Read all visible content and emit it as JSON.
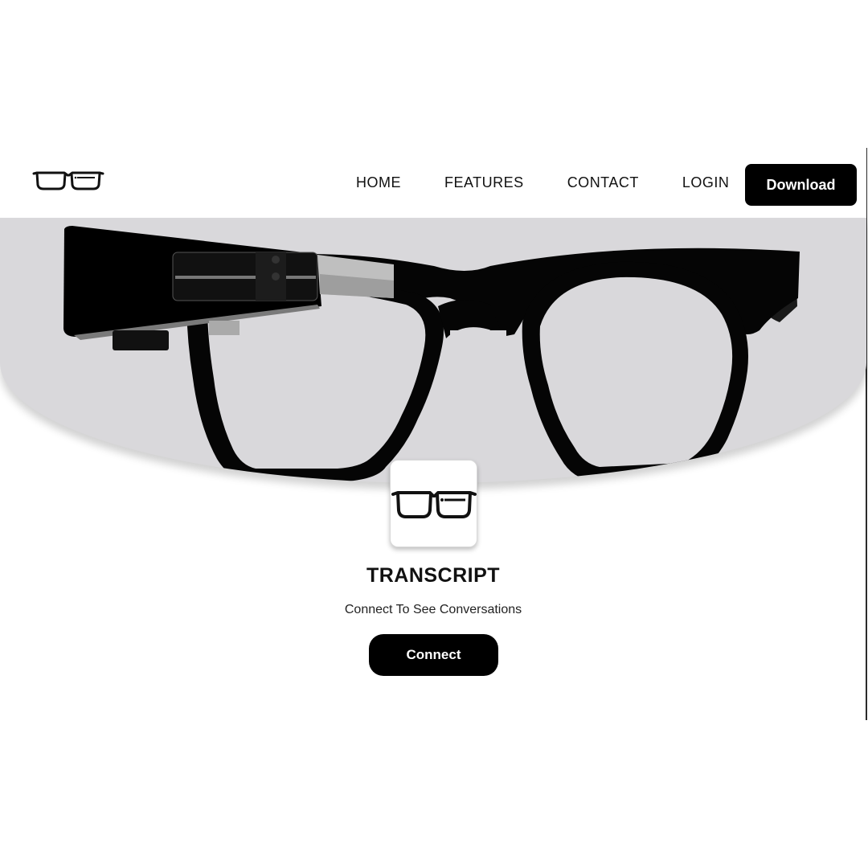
{
  "nav": {
    "logo_icon": "glasses-icon",
    "links": [
      {
        "label": "HOME"
      },
      {
        "label": "FEATURES"
      },
      {
        "label": "CONTACT"
      },
      {
        "label": "LOGIN"
      }
    ],
    "download_label": "Download"
  },
  "hero": {
    "image": "smart-glasses-illustration",
    "background_color": "#d9d8db"
  },
  "transcript": {
    "icon": "glasses-icon",
    "title": "TRANSCRIPT",
    "subtitle": "Connect To See Conversations",
    "connect_label": "Connect"
  },
  "colors": {
    "primary": "#000000",
    "background": "#ffffff",
    "hero": "#d9d8db"
  }
}
